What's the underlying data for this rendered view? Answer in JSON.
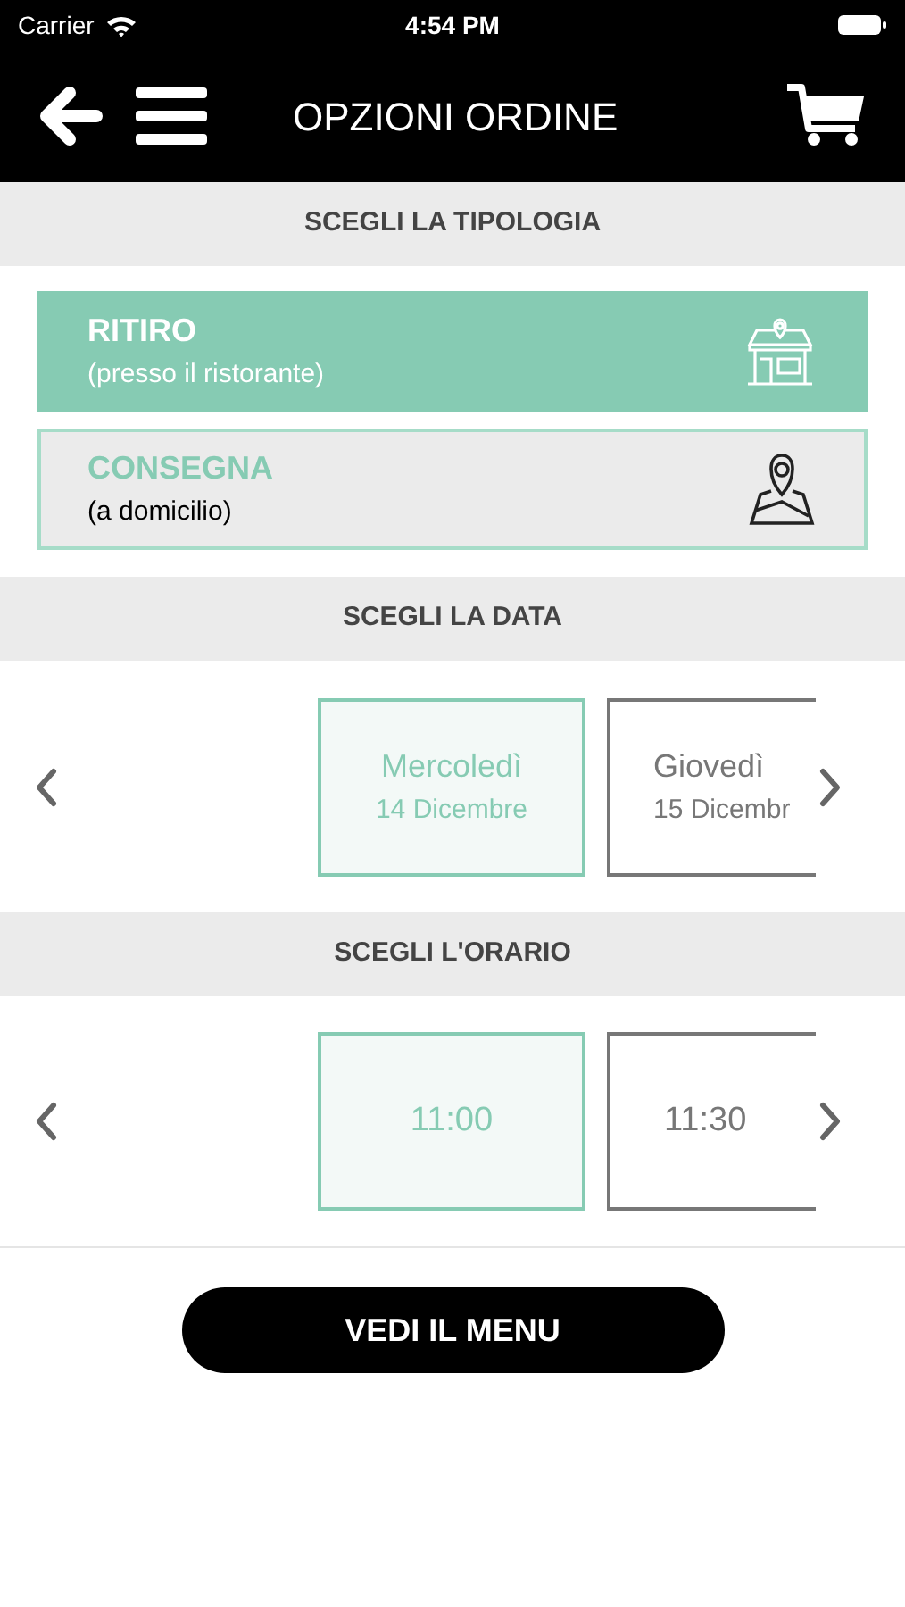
{
  "status_bar": {
    "carrier": "Carrier",
    "time": "4:54 PM"
  },
  "header": {
    "title": "OPZIONI ORDINE"
  },
  "type_section": {
    "title": "SCEGLI LA TIPOLOGIA",
    "options": [
      {
        "kind": "pickup",
        "label": "RITIRO",
        "sublabel": "(presso il ristorante)",
        "selected": true
      },
      {
        "kind": "delivery",
        "label": "CONSEGNA",
        "sublabel": "(a domicilio)",
        "selected": false
      }
    ]
  },
  "date_section": {
    "title": "SCEGLI LA DATA",
    "dates": [
      {
        "day": "Mercoledì",
        "date": "14 Dicembre",
        "selected": true
      },
      {
        "day": "Giovedì",
        "date": "15 Dicembr",
        "selected": false
      }
    ]
  },
  "time_section": {
    "title": "SCEGLI L'ORARIO",
    "times": [
      {
        "label": "11:00",
        "selected": true
      },
      {
        "label": "11:30",
        "selected": false
      }
    ]
  },
  "menu_button": {
    "label": "VEDI IL MENU"
  }
}
